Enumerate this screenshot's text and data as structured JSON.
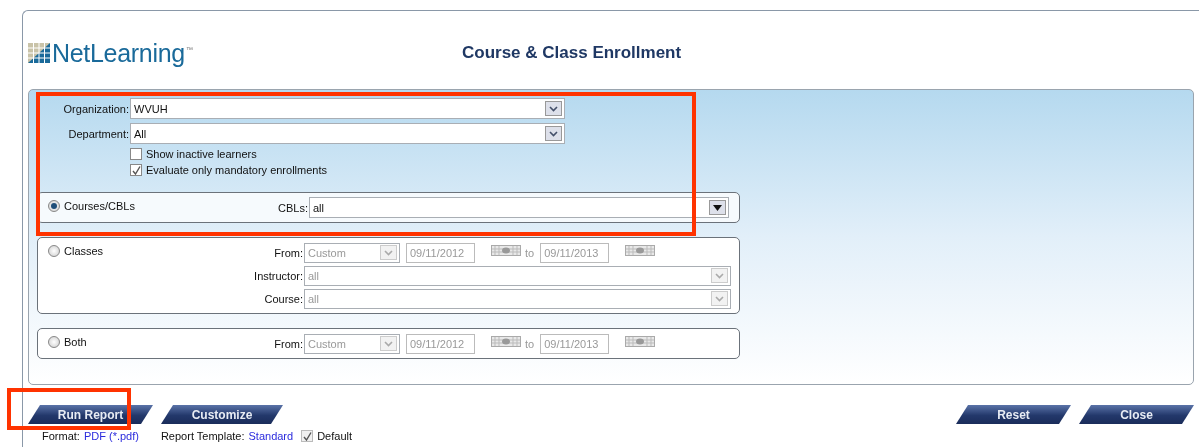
{
  "logo": {
    "text": "NetLearning",
    "mark": "™"
  },
  "title": "Course & Class Enrollment",
  "filters": {
    "highlighted": true,
    "fields": [
      {
        "label": "Organization:",
        "value": "WVUH"
      },
      {
        "label": "Department:",
        "value": "All"
      }
    ],
    "options": [
      {
        "label": "Show inactive learners",
        "checked": false
      },
      {
        "label": "Evaluate only mandatory enrollments",
        "checked": true
      }
    ]
  },
  "modes": [
    {
      "label": "Courses/CBLs",
      "selected": true,
      "fields": [
        {
          "kind": "select",
          "label": "CBLs:",
          "value": "all",
          "disabled": false
        }
      ]
    },
    {
      "label": "Classes",
      "selected": false,
      "fields": [
        {
          "kind": "range",
          "label": "From:",
          "preset": "Custom",
          "start": "09/11/2012",
          "joiner": "to",
          "end": "09/11/2013",
          "disabled": true
        },
        {
          "kind": "select",
          "label": "Instructor:",
          "value": "all",
          "disabled": true
        },
        {
          "kind": "select",
          "label": "Course:",
          "value": "all",
          "disabled": true
        }
      ]
    },
    {
      "label": "Both",
      "selected": false,
      "fields": [
        {
          "kind": "range",
          "label": "From:",
          "preset": "Custom",
          "start": "09/11/2012",
          "joiner": "to",
          "end": "09/11/2013",
          "disabled": true
        }
      ]
    }
  ],
  "actions_left": [
    {
      "label": "Run Report",
      "highlighted": true
    },
    {
      "label": "Customize",
      "highlighted": false
    }
  ],
  "actions_right": [
    {
      "label": "Reset"
    },
    {
      "label": "Close"
    }
  ],
  "footer": {
    "format_label": "Format:",
    "format_value": "PDF (*.pdf)",
    "template_label": "Report Template:",
    "template_value": "Standard",
    "default": {
      "label": "Default",
      "checked": true,
      "disabled": true
    }
  }
}
